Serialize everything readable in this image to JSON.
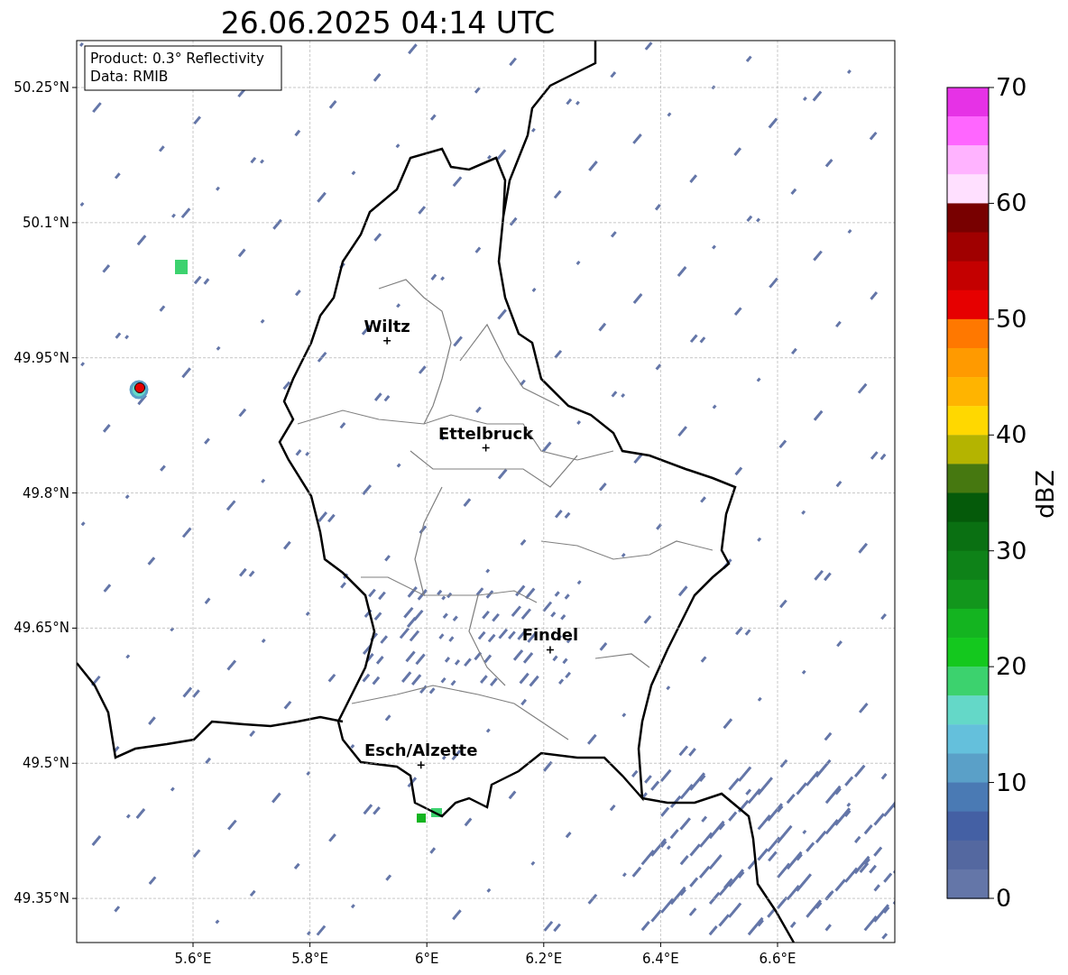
{
  "title": "26.06.2025 04:14 UTC",
  "info": [
    "Product: 0.3° Reflectivity",
    "Data: RMIB"
  ],
  "xticks": [
    "5.6°E",
    "5.8°E",
    "6°E",
    "6.2°E",
    "6.4°E",
    "6.6°E"
  ],
  "yticks": [
    "50.25°N",
    "50.1°N",
    "49.95°N",
    "49.8°N",
    "49.65°N",
    "49.5°N",
    "49.35°N"
  ],
  "cities": [
    {
      "name": "Wiltz"
    },
    {
      "name": "Ettelbruck"
    },
    {
      "name": "Findel"
    },
    {
      "name": "Esch/Alzette"
    }
  ],
  "colorbar": {
    "label": "dBZ",
    "ticks": [
      "70",
      "60",
      "50",
      "40",
      "30",
      "20",
      "10",
      "0"
    ],
    "bands": [
      {
        "color": "#e632e6"
      },
      {
        "color": "#ff66ff"
      },
      {
        "color": "#ffb3ff"
      },
      {
        "color": "#ffe0ff"
      },
      {
        "color": "#780000"
      },
      {
        "color": "#a00000"
      },
      {
        "color": "#c40000"
      },
      {
        "color": "#e60000"
      },
      {
        "color": "#ff7800"
      },
      {
        "color": "#ff9a00"
      },
      {
        "color": "#ffb400"
      },
      {
        "color": "#ffd800"
      },
      {
        "color": "#b4b400"
      },
      {
        "color": "#467810"
      },
      {
        "color": "#055a0a"
      },
      {
        "color": "#0a7012"
      },
      {
        "color": "#0e8218"
      },
      {
        "color": "#12961c"
      },
      {
        "color": "#14b420"
      },
      {
        "color": "#14c81e"
      },
      {
        "color": "#3cd26e"
      },
      {
        "color": "#64d8c8"
      },
      {
        "color": "#64c0dc"
      },
      {
        "color": "#5aa0c8"
      },
      {
        "color": "#4a7ab4"
      },
      {
        "color": "#4460a4"
      },
      {
        "color": "#5468a0"
      },
      {
        "color": "#6476a8"
      }
    ]
  }
}
